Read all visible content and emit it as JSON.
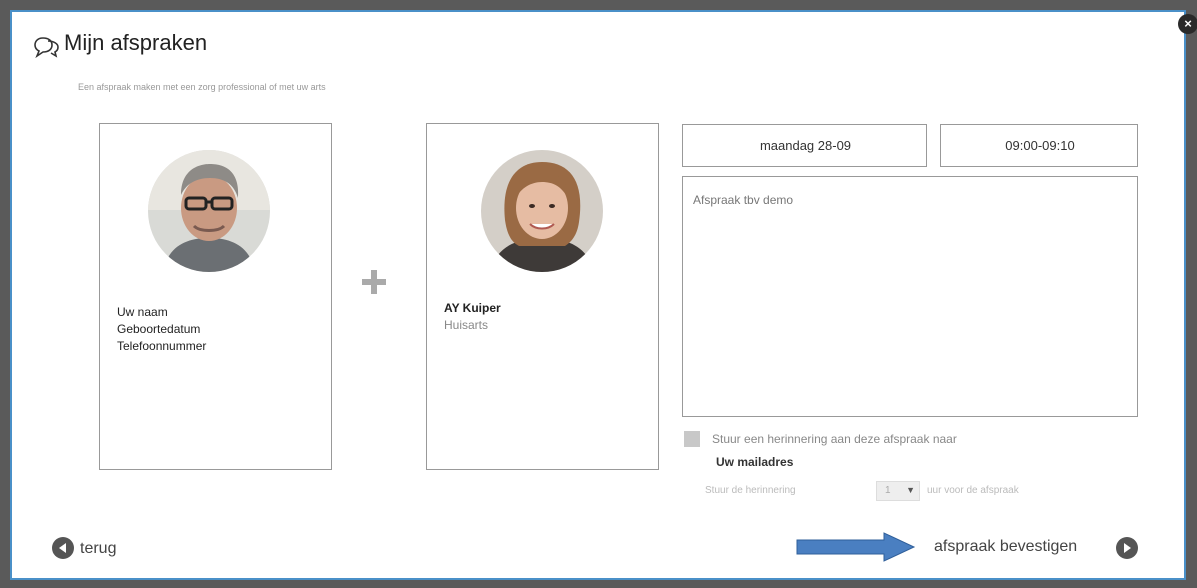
{
  "header": {
    "title": "Mijn afspraken",
    "subtitle": "Een afspraak maken met een zorg professional of met uw arts",
    "icon": "chat-bubbles-icon"
  },
  "patient": {
    "name_label": "Uw naam",
    "dob_label": "Geboortedatum",
    "phone_label": "Telefoonnummer",
    "avatar": "patient-avatar"
  },
  "doctor": {
    "name": "AY Kuiper",
    "role": "Huisarts",
    "avatar": "doctor-avatar"
  },
  "appointment": {
    "date": "maandag 28-09",
    "time": "09:00-09:10",
    "notes": "Afspraak tbv demo"
  },
  "reminder": {
    "label": "Stuur een herinnering aan deze afspraak naar",
    "target": "Uw mailadres",
    "prefix": "Stuur de herinnering",
    "hours_value": "1",
    "suffix": "uur voor de afspraak"
  },
  "nav": {
    "back_label": "terug",
    "confirm_label": "afspraak bevestigen"
  },
  "colors": {
    "border": "#4a90c8",
    "annotation_arrow": "#4a7fc1"
  }
}
